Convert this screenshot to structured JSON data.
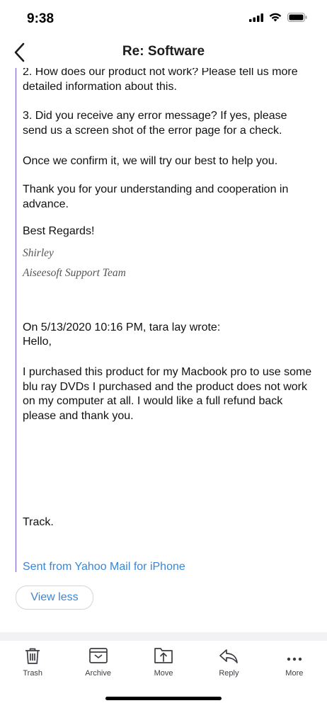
{
  "status": {
    "time": "9:38"
  },
  "header": {
    "title": "Re: Software"
  },
  "body": {
    "q2": "2. How does our product not work? Please tell us more detailed information about this.",
    "q3": "3. Did you receive any error message? If yes, please send us a screen shot of the error page for a check.",
    "confirm": "Once we confirm it, we will try our best to help you.",
    "thanks": "Thank you for your understanding and cooperation in advance.",
    "regards": "Best Regards!",
    "sig_name": "Shirley",
    "sig_team": "Aiseesoft Support Team",
    "quote_header": "On 5/13/2020 10:16 PM, tara lay wrote:",
    "greeting": "Hello,",
    "message": "I purchased this product for my Macbook pro to use some blu ray DVDs I purchased and the product does not work on my computer at all. I would like a full refund back please and thank you.",
    "track": "Track.",
    "sent_from": "Sent from Yahoo Mail for iPhone"
  },
  "view_less_label": "View less",
  "toolbar": {
    "items": [
      {
        "label": "Trash",
        "icon": "trash-icon"
      },
      {
        "label": "Archive",
        "icon": "archive-icon"
      },
      {
        "label": "Move",
        "icon": "move-icon"
      },
      {
        "label": "Reply",
        "icon": "reply-icon"
      },
      {
        "label": "More",
        "icon": "more-icon"
      }
    ]
  },
  "colors": {
    "link": "#3a86d6",
    "quote_bar": "#6d55c9"
  }
}
